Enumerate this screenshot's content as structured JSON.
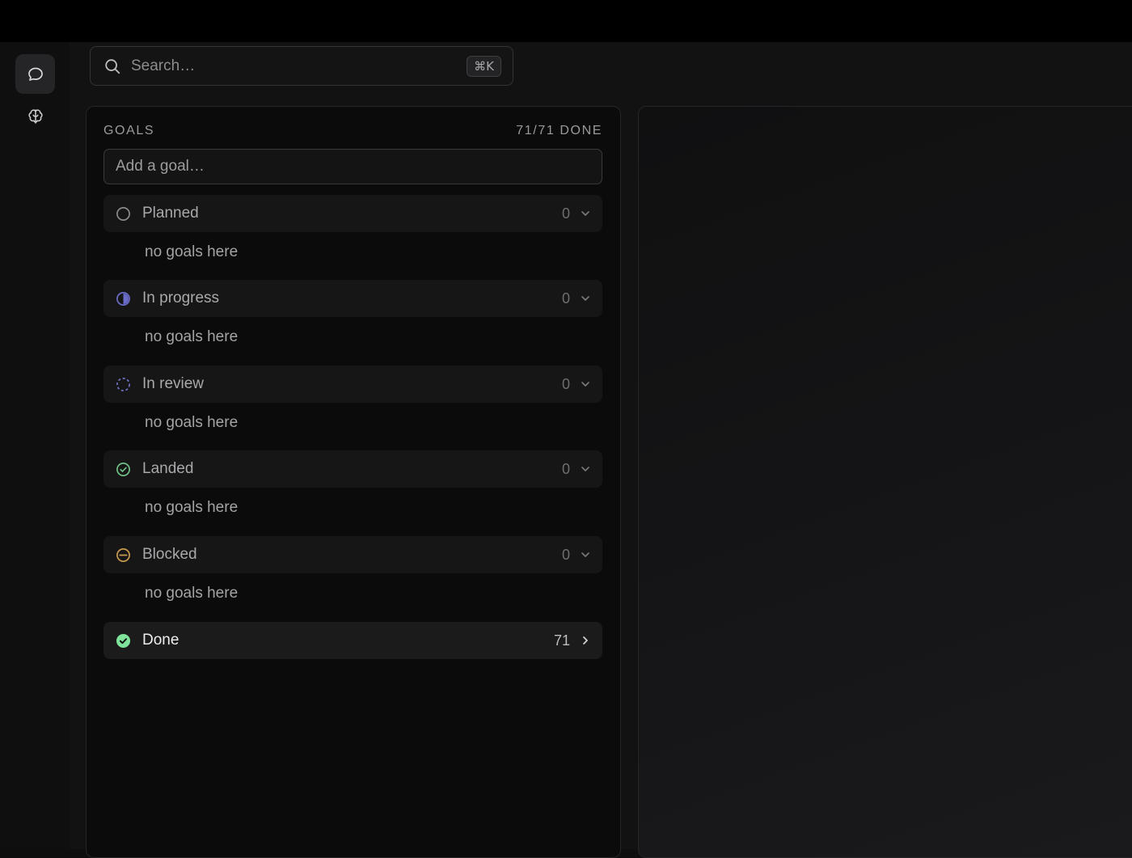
{
  "search": {
    "placeholder": "Search…",
    "shortcut": "⌘K"
  },
  "sidebar": {
    "items": [
      {
        "name": "chat",
        "icon": "chat-bubble-icon",
        "active": true
      },
      {
        "name": "brain",
        "icon": "brain-icon",
        "active": false
      }
    ]
  },
  "goals": {
    "title": "GOALS",
    "summary": "71/71 DONE",
    "add_placeholder": "Add a goal…",
    "empty_text": "no goals here",
    "groups": [
      {
        "label": "Planned",
        "count": "0",
        "icon": "circle-outline-icon",
        "color": "#8a8a8c",
        "expanded": true
      },
      {
        "label": "In progress",
        "count": "0",
        "icon": "half-circle-icon",
        "color": "#6b6bc9",
        "expanded": true
      },
      {
        "label": "In review",
        "count": "0",
        "icon": "dashed-circle-icon",
        "color": "#7272c8",
        "expanded": true
      },
      {
        "label": "Landed",
        "count": "0",
        "icon": "check-circle-outline-icon",
        "color": "#6fbf86",
        "expanded": true
      },
      {
        "label": "Blocked",
        "count": "0",
        "icon": "minus-circle-icon",
        "color": "#c99a4e",
        "expanded": true
      },
      {
        "label": "Done",
        "count": "71",
        "icon": "check-circle-filled-icon",
        "color": "#7ee29a",
        "expanded": false
      }
    ]
  }
}
